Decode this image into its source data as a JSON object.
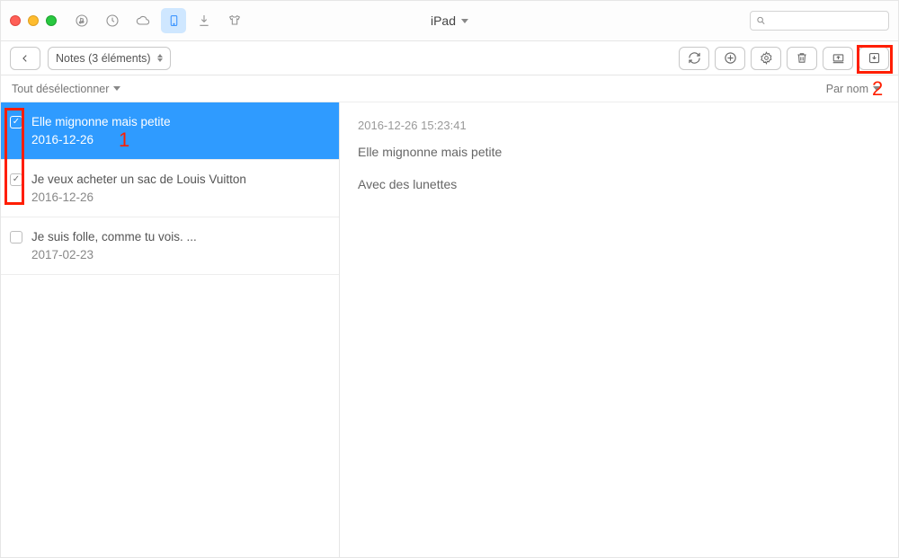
{
  "header": {
    "device_title": "iPad",
    "search_placeholder": ""
  },
  "toolbar": {
    "back_label": "",
    "breadcrumb": "Notes (3 éléments)"
  },
  "filter": {
    "select_all": "Tout désélectionner",
    "sort": "Par nom"
  },
  "notes": [
    {
      "title": "Elle mignonne mais petite",
      "date": "2016-12-26",
      "checked": true,
      "selected": true
    },
    {
      "title": "Je veux acheter un sac de Louis Vuitton",
      "date": "2016-12-26",
      "checked": true,
      "selected": false
    },
    {
      "title": "Je suis folle, comme tu vois. ...",
      "date": "2017-02-23",
      "checked": false,
      "selected": false
    }
  ],
  "detail": {
    "timestamp": "2016-12-26 15:23:41",
    "line1": "Elle mignonne mais petite",
    "line2": "Avec des lunettes"
  },
  "annotations": {
    "num1": "1",
    "num2": "2"
  }
}
